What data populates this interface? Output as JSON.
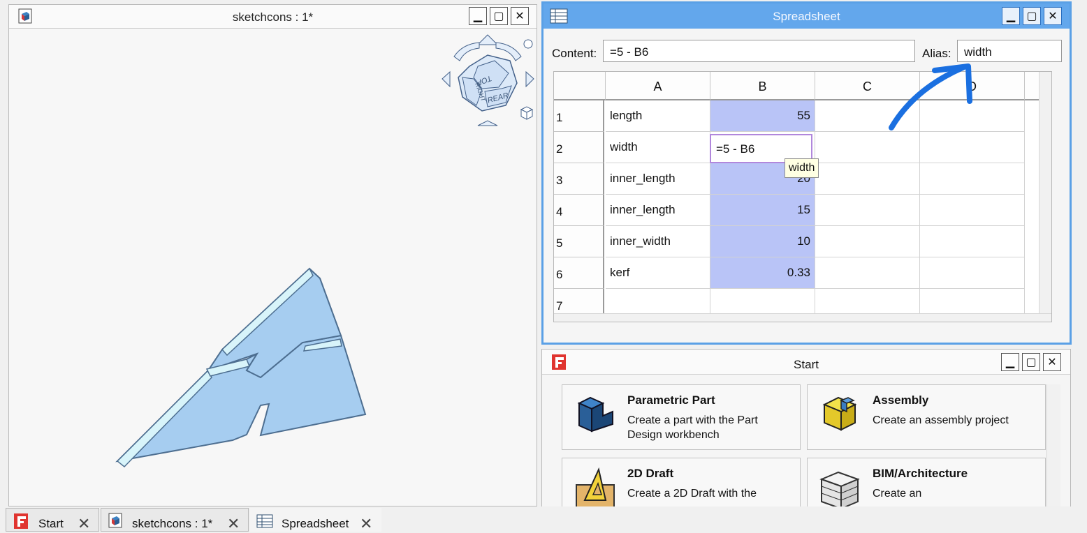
{
  "view3d": {
    "title": "sketchcons : 1*",
    "navcube_faces": {
      "top": "TOP",
      "right": "RIGHT",
      "rear": "REAR"
    }
  },
  "spreadsheet": {
    "title": "Spreadsheet",
    "content_label": "Content:",
    "content_value": "=5 - B6",
    "alias_label": "Alias:",
    "alias_value": "width",
    "columns": [
      "A",
      "B",
      "C",
      "D"
    ],
    "rows": [
      {
        "num": "1",
        "a": "length",
        "b": "55"
      },
      {
        "num": "2",
        "a": "width",
        "b": ""
      },
      {
        "num": "3",
        "a": "inner_length",
        "b": "20"
      },
      {
        "num": "4",
        "a": "inner_length",
        "b": "15"
      },
      {
        "num": "5",
        "a": "inner_width",
        "b": "10"
      },
      {
        "num": "6",
        "a": "kerf",
        "b": "0.33"
      },
      {
        "num": "7",
        "a": "",
        "b": ""
      }
    ],
    "editor_value": "=5 - B6",
    "tooltip": "width"
  },
  "start": {
    "title": "Start",
    "cards": [
      {
        "title": "Parametric Part",
        "desc": "Create a part with the Part Design workbench"
      },
      {
        "title": "Assembly",
        "desc": "Create an assembly project"
      },
      {
        "title": "2D Draft",
        "desc": "Create a 2D Draft with the"
      },
      {
        "title": "BIM/Architecture",
        "desc": "Create an"
      }
    ]
  },
  "tabs": [
    {
      "label": "Start"
    },
    {
      "label": "sketchcons : 1*"
    },
    {
      "label": "Spreadsheet"
    }
  ],
  "colors": {
    "accent": "#63a7ec",
    "cell_highlight": "#b9c4f7",
    "model_fill": "#a6cdf0",
    "annotation_arrow": "#1a6fe0"
  }
}
